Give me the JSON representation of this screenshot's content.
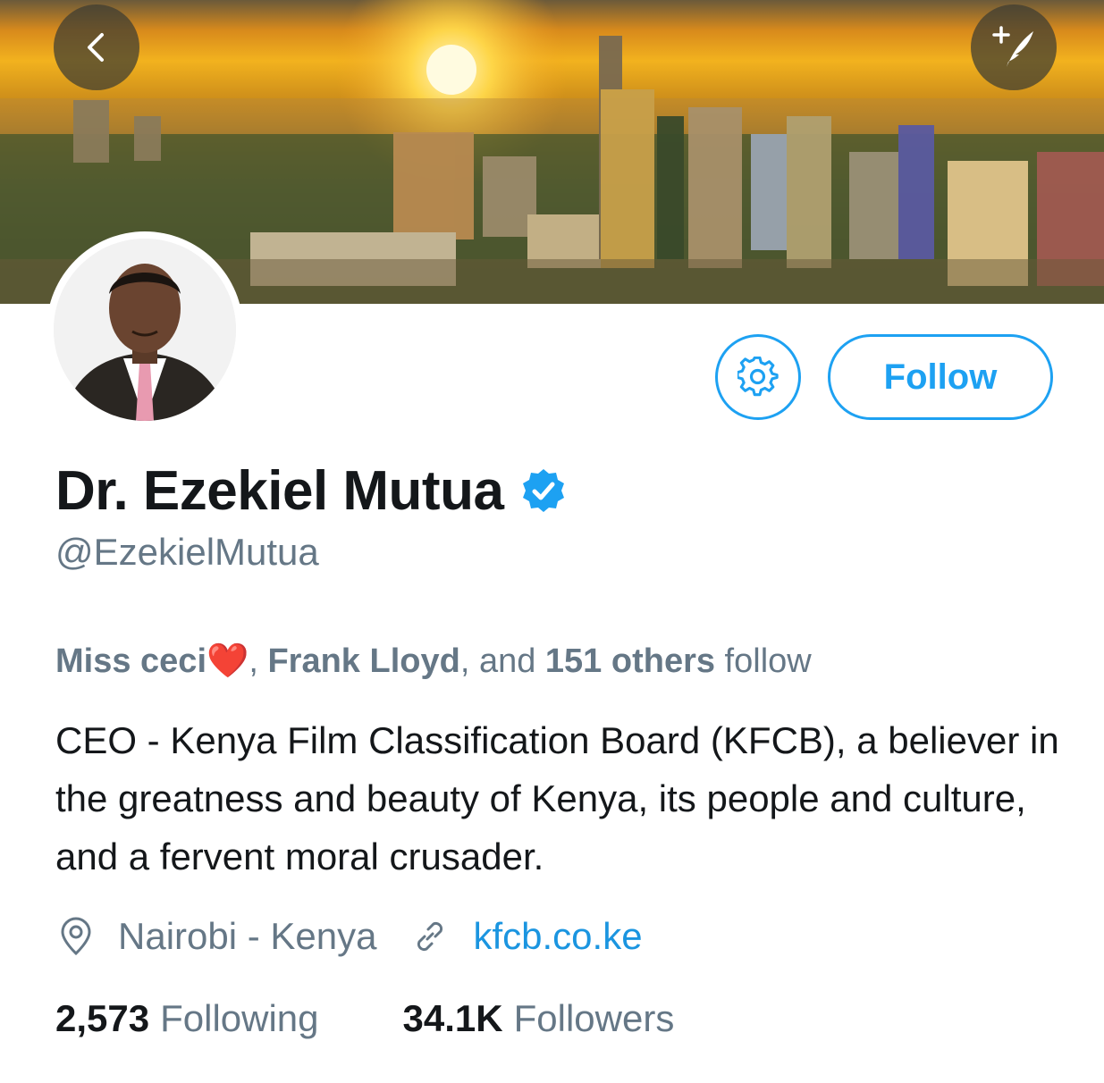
{
  "header": {
    "back_icon": "chevron-left-icon",
    "compose_icon": "compose-tweet-icon"
  },
  "profile": {
    "display_name": "Dr. Ezekiel Mutua",
    "verified": true,
    "handle": "@EzekielMutua",
    "follow_label": "Follow",
    "settings_icon": "gear-icon"
  },
  "followed_by": {
    "first": "Miss ceci",
    "first_emoji": "❤️",
    "sep1": ", ",
    "second": "Frank Lloyd",
    "mid": ", and ",
    "count": "151 others",
    "tail": " follow"
  },
  "bio": "CEO - Kenya Film Classification Board (KFCB), a believer in the greatness and beauty of Kenya, its people and culture, and a fervent moral crusader.",
  "meta": {
    "location": "Nairobi - Kenya",
    "website": "kfcb.co.ke"
  },
  "stats": {
    "following_count": "2,573",
    "following_label": "Following",
    "followers_count": "34.1K",
    "followers_label": "Followers"
  },
  "colors": {
    "accent": "#1da1f2",
    "link": "#1b95e0",
    "secondary_text": "#657786",
    "primary_text": "#14171a"
  }
}
